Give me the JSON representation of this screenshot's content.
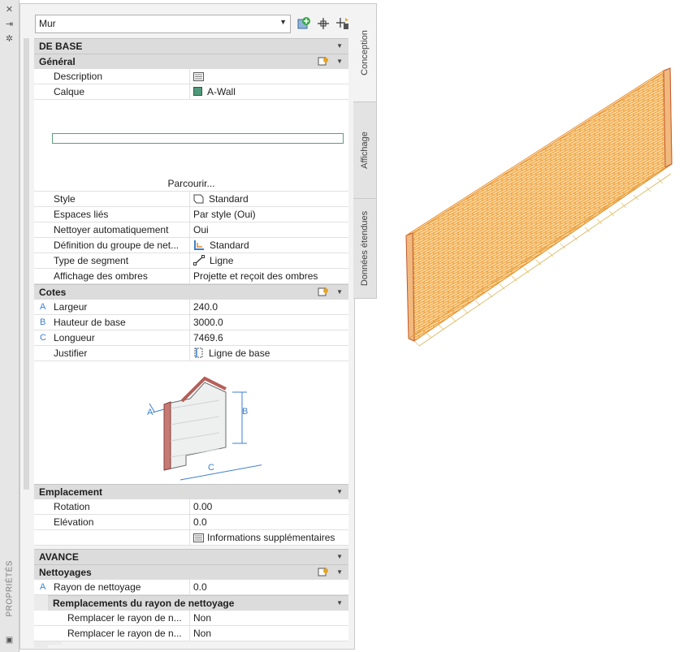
{
  "palette": {
    "title": "PROPRIÉTÉS"
  },
  "selector": {
    "value": "Mur"
  },
  "sections": {
    "de_base": "DE BASE",
    "general": "Général",
    "cotes": "Cotes",
    "emplacement": "Emplacement",
    "avance": "AVANCE",
    "nettoyages": "Nettoyages",
    "remplacements": "Remplacements du rayon de nettoyage"
  },
  "general": {
    "description_label": "Description",
    "calque_label": "Calque",
    "calque_value": "A-Wall",
    "browse_label": "Parcourir...",
    "rows": [
      {
        "label": "Style",
        "value": "Standard"
      },
      {
        "label": "Espaces liés",
        "value": "Par style (Oui)"
      },
      {
        "label": "Nettoyer automatiquement",
        "value": "Oui"
      },
      {
        "label": "Définition du groupe de net...",
        "value": "Standard"
      },
      {
        "label": "Type de segment",
        "value": "Ligne"
      },
      {
        "label": "Affichage des ombres",
        "value": "Projette et reçoit des ombres"
      }
    ]
  },
  "cotes": {
    "rows": [
      {
        "mark": "A",
        "label": "Largeur",
        "value": "240.0"
      },
      {
        "mark": "B",
        "label": "Hauteur de base",
        "value": "3000.0"
      },
      {
        "mark": "C",
        "label": "Longueur",
        "value": "7469.6"
      },
      {
        "mark": "",
        "label": "Justifier",
        "value": "Ligne de base"
      }
    ],
    "diagram_labels": {
      "a": "A",
      "b": "B",
      "c": "C"
    }
  },
  "emplacement": {
    "rows": [
      {
        "label": "Rotation",
        "value": "0.00"
      },
      {
        "label": "Elévation",
        "value": "0.0"
      }
    ],
    "extra_info": "Informations supplémentaires"
  },
  "nettoyages": {
    "rayon_mark": "A",
    "rayon_label": "Rayon de nettoyage",
    "rayon_value": "0.0",
    "overrides": [
      {
        "label": "Remplacer le rayon de n...",
        "value": "Non"
      },
      {
        "label": "Remplacer le rayon de n...",
        "value": "Non"
      }
    ]
  },
  "tabs": [
    "Conception",
    "Affichage",
    "Données étendues"
  ],
  "colors": {
    "layer_swatch": "#4f9a7a",
    "wall_stroke": "#e8891e",
    "dim_blue": "#3b7fd0"
  }
}
